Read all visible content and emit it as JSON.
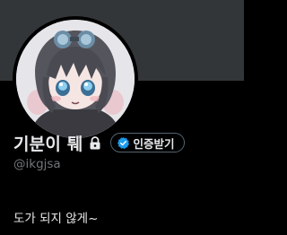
{
  "profile": {
    "display_name": "기분이 퉤",
    "handle": "@ikgjsa",
    "bio": "도가 되지 않게~",
    "verify_button_label": "인증받기",
    "lock_icon": "lock-icon",
    "verified_icon": "verified-badge-icon",
    "avatar_alt": "avatar"
  },
  "colors": {
    "background": "#000000",
    "banner": "#333639",
    "text_primary": "#e7e9ea",
    "text_secondary": "#71767b",
    "verified_blue": "#1d9bf0",
    "button_border": "#536471"
  }
}
